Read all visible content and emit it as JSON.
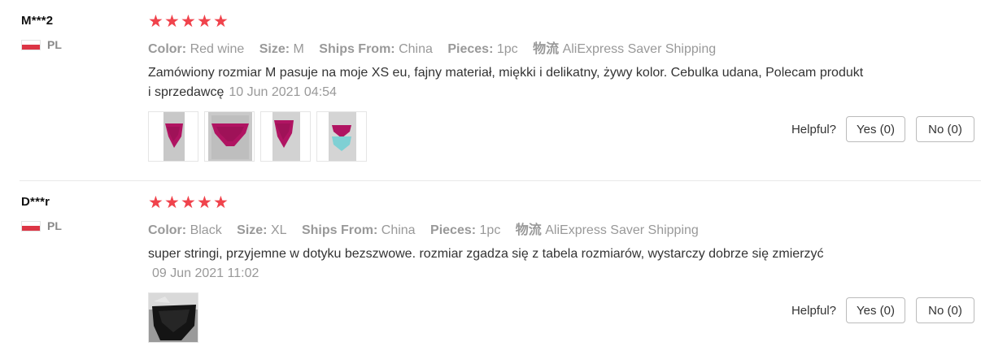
{
  "reviews": [
    {
      "user": "M***2",
      "country": "PL",
      "rating": 5,
      "attributes": [
        {
          "key": "Color:",
          "value": "Red wine"
        },
        {
          "key": "Size:",
          "value": "M"
        },
        {
          "key": "Ships From:",
          "value": "China"
        },
        {
          "key": "Pieces:",
          "value": "1pc"
        },
        {
          "key": "物流",
          "value": "AliExpress Saver Shipping"
        }
      ],
      "text": "Zamówiony rozmiar M pasuje na moje XS eu, fajny materiał, miękki i delikatny, żywy kolor. Cebulka udana, Polecam produkt i sprzedawcę",
      "date": "10 Jun 2021 04:54",
      "images": [
        "red-panties-photo-1",
        "red-panties-photo-2",
        "red-panties-photo-3",
        "red-and-blue-panties-photo"
      ],
      "helpful_label": "Helpful?",
      "yes_label": "Yes (0)",
      "no_label": "No (0)"
    },
    {
      "user": "D***r",
      "country": "PL",
      "rating": 5,
      "attributes": [
        {
          "key": "Color:",
          "value": "Black"
        },
        {
          "key": "Size:",
          "value": "XL"
        },
        {
          "key": "Ships From:",
          "value": "China"
        },
        {
          "key": "Pieces:",
          "value": "1pc"
        },
        {
          "key": "物流",
          "value": "AliExpress Saver Shipping"
        }
      ],
      "text": "super stringi, przyjemne w dotyku bezszwowe. rozmiar zgadza się z tabela rozmiarów, wystarczy dobrze się zmierzyć",
      "date": "09 Jun 2021 11:02",
      "images": [
        "black-panties-photo"
      ],
      "helpful_label": "Helpful?",
      "yes_label": "Yes (0)",
      "no_label": "No (0)"
    }
  ],
  "colors": {
    "star": "#f0434c",
    "flag_red": "#dc3545",
    "muted_text": "#999999"
  }
}
